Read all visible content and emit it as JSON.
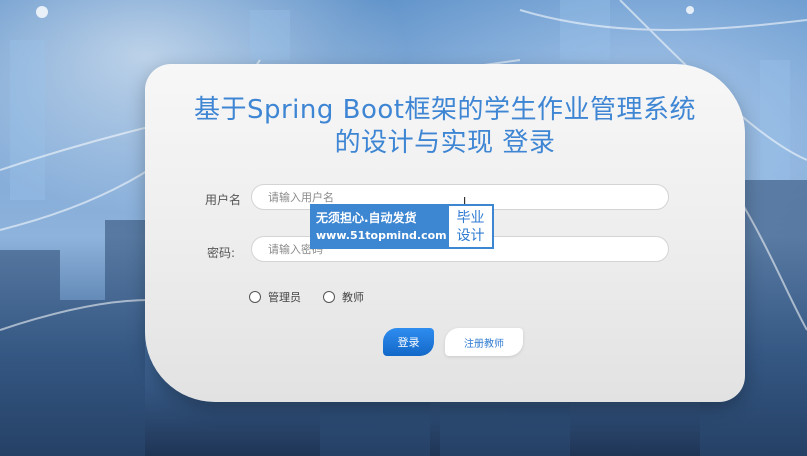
{
  "login": {
    "title_line1": "基于Spring Boot框架的学生作业管理系统",
    "title_line2": "的设计与实现 登录",
    "username_label": "用户名",
    "username_placeholder": "请输入用户名",
    "password_label": "密码:",
    "password_placeholder": "请输入密码",
    "roles": [
      "管理员",
      "教师"
    ],
    "login_button": "登录",
    "register_button": "注册教师"
  },
  "watermark": {
    "line1": "无须担心.自动发货",
    "line2": "www.51topmind.com",
    "badge_line1": "毕业",
    "badge_line2": "设计"
  },
  "colors": {
    "title": "#3e86d4",
    "login_button": "#1a76dd",
    "watermark_blue": "#3d86d2"
  }
}
